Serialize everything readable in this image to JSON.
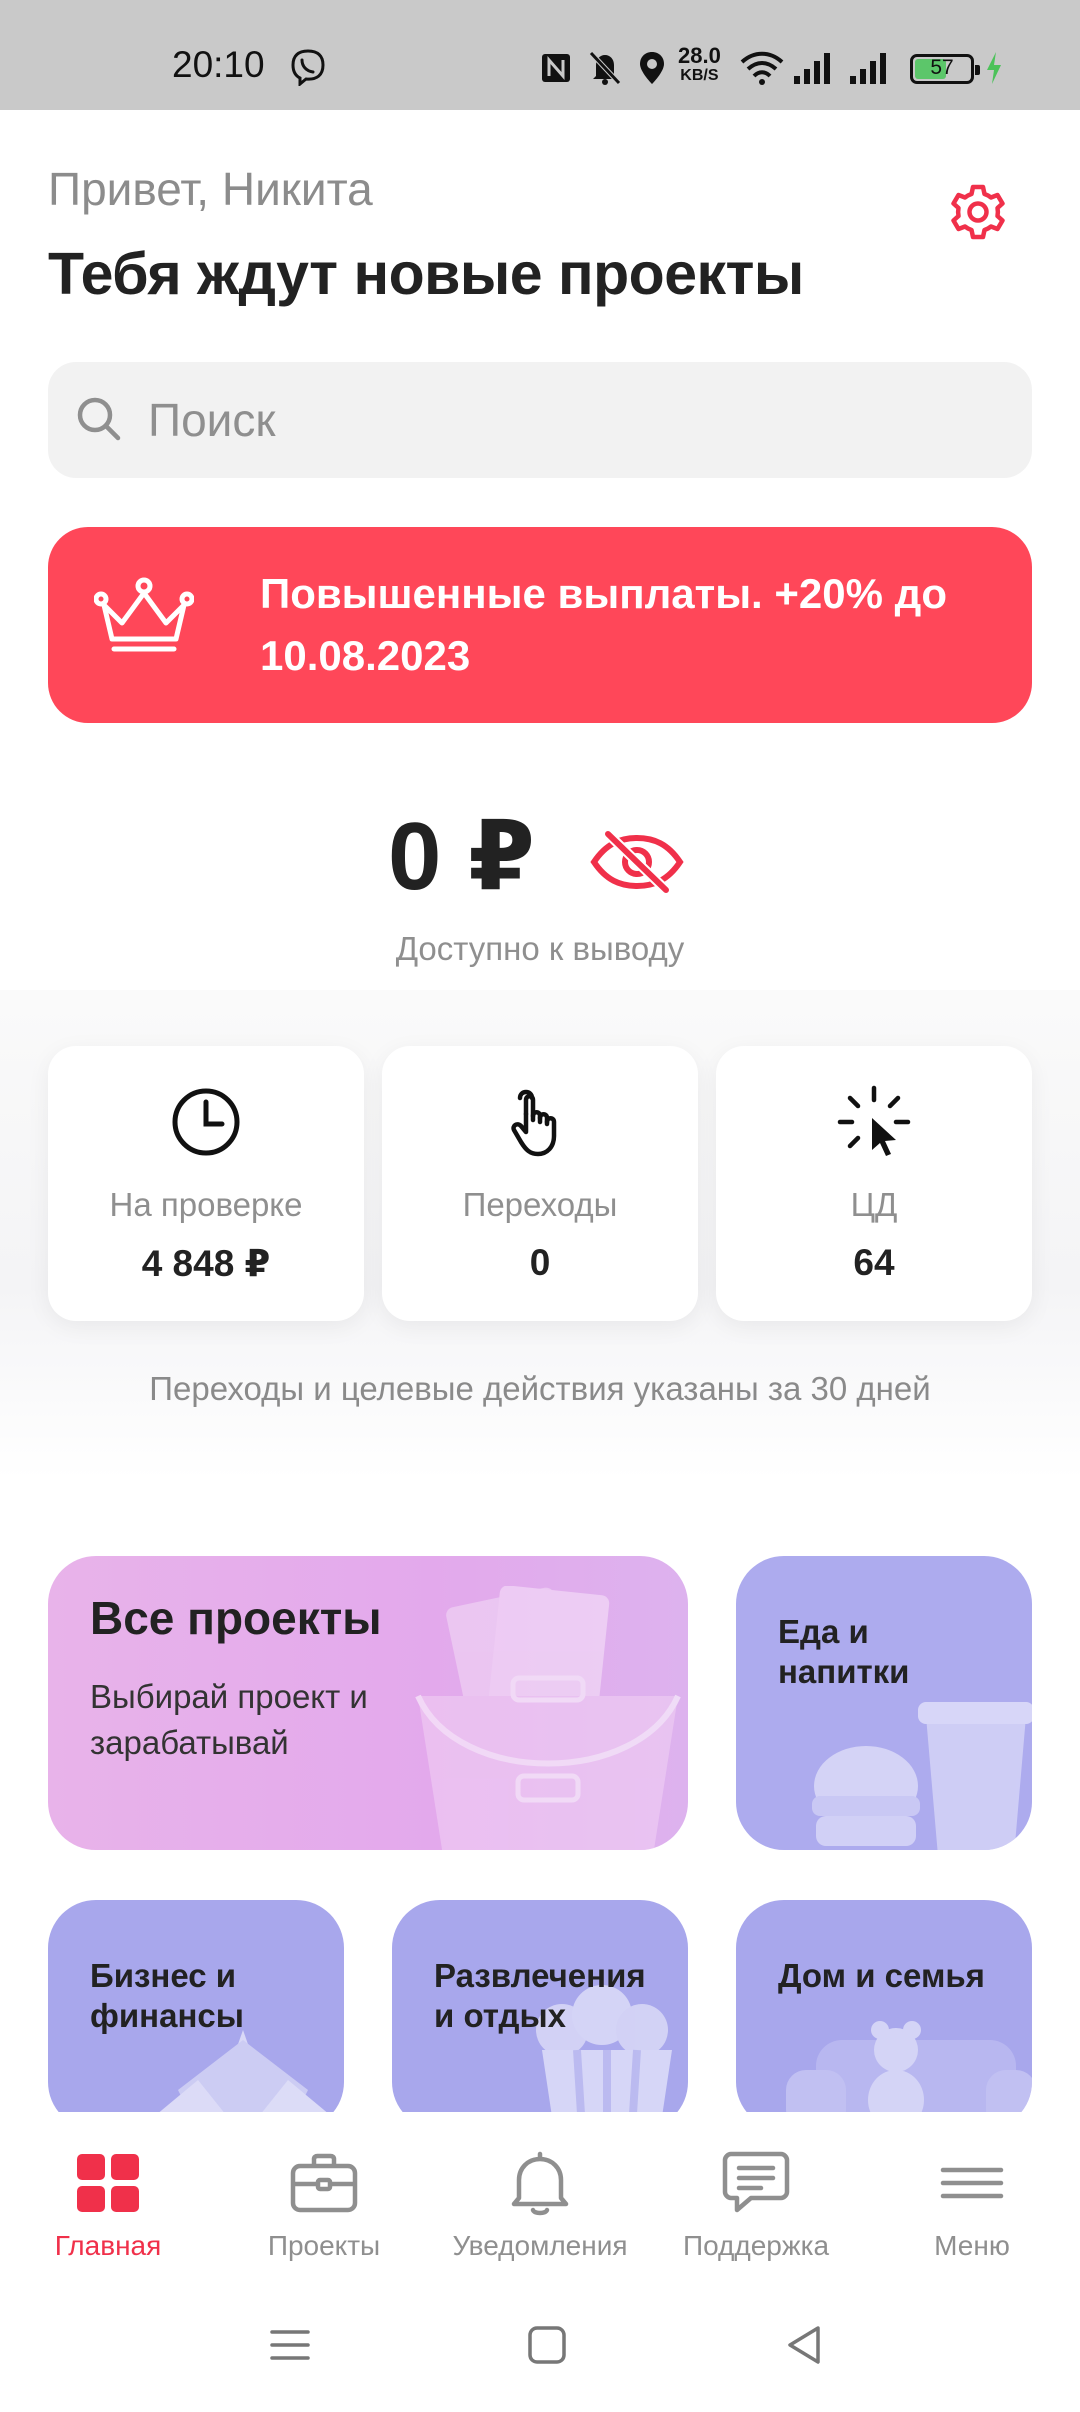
{
  "status_bar": {
    "time": "20:10",
    "network_speed": "28.0",
    "network_speed_unit": "KB/S",
    "battery": "57",
    "battery_level": 0.57,
    "icons": [
      "viber-icon",
      "nfc-icon",
      "mute-icon",
      "location-icon",
      "wifi-icon",
      "signal-icon",
      "signal-icon",
      "battery-icon",
      "charging-icon"
    ]
  },
  "header": {
    "greeting": "Привет, Никита",
    "title": "Тебя ждут новые проекты",
    "settings_icon": "gear-icon"
  },
  "search": {
    "placeholder": "Поиск"
  },
  "promo_banner": {
    "text": "Повышенные выплаты. +20% до 10.08.2023",
    "icon": "crown-icon",
    "color": "#ff4759"
  },
  "balance": {
    "amount": "0 ₽",
    "caption": "Доступно к выводу",
    "visibility_icon": "eye-off-icon"
  },
  "stats": [
    {
      "label": "На проверке",
      "value": "4 848 ₽",
      "icon": "clock-icon"
    },
    {
      "label": "Переходы",
      "value": "0",
      "icon": "tap-hand-icon"
    },
    {
      "label": "ЦД",
      "value": "64",
      "icon": "click-cursor-icon"
    }
  ],
  "stats_note": "Переходы и целевые действия указаны за 30 дней",
  "categories": {
    "all": {
      "title": "Все проекты",
      "subtitle": "Выбирай проект и зарабатывай"
    },
    "food": {
      "title": "Еда и напитки"
    },
    "business": {
      "title": "Бизнес и финансы"
    },
    "entertainment": {
      "title": "Развлечения и отдых"
    },
    "home": {
      "title": "Дом и семья"
    }
  },
  "bottom_nav": [
    {
      "label": "Главная",
      "icon": "grid-icon",
      "active": true
    },
    {
      "label": "Проекты",
      "icon": "briefcase-icon",
      "active": false
    },
    {
      "label": "Уведомления",
      "icon": "bell-icon",
      "active": false
    },
    {
      "label": "Поддержка",
      "icon": "chat-icon",
      "active": false
    },
    {
      "label": "Меню",
      "icon": "menu-icon",
      "active": false
    }
  ],
  "colors": {
    "accent": "#f0304a",
    "banner": "#ff4759",
    "category_purple": "#a8a7ec",
    "category_pink": "#e3a9ec"
  }
}
